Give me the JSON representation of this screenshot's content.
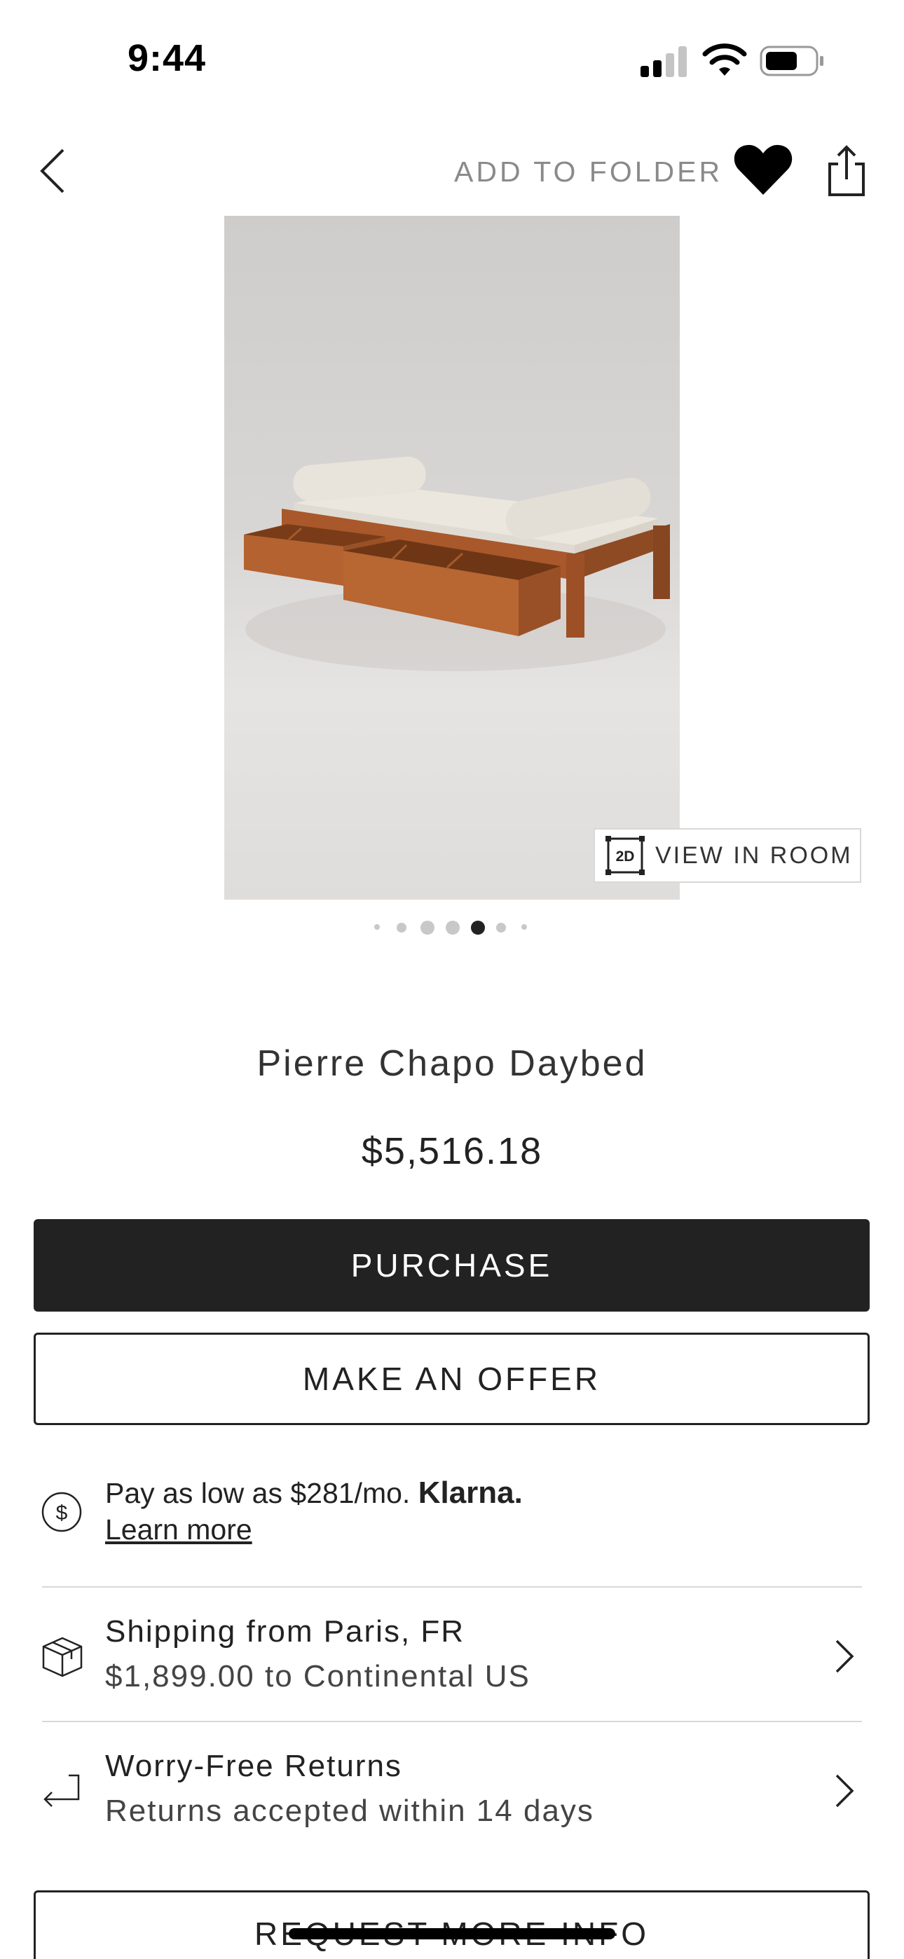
{
  "status_bar": {
    "time": "9:44"
  },
  "nav": {
    "add_to_folder": "ADD TO FOLDER"
  },
  "product": {
    "view_in_room": "VIEW IN ROOM",
    "view_in_room_badge": "2D",
    "image_count": 7,
    "active_image_index": 4,
    "title": "Pierre Chapo Daybed",
    "price": "$5,516.18"
  },
  "actions": {
    "purchase": "PURCHASE",
    "make_offer": "MAKE AN OFFER",
    "request_info": "REQUEST MORE INFO"
  },
  "klarna": {
    "text": "Pay as low as $281/mo.",
    "brand": "Klarna.",
    "link": "Learn more",
    "icon_symbol": "$"
  },
  "shipping": {
    "title": "Shipping from Paris, FR",
    "detail": "$1,899.00 to Continental US"
  },
  "returns": {
    "title": "Worry-Free Returns",
    "detail": "Returns accepted within 14 days"
  },
  "icons": {
    "back": "chevron-left-icon",
    "favorite": "heart-icon",
    "share": "share-icon",
    "shipping": "box-icon",
    "returns": "return-arrow-icon"
  },
  "colors": {
    "primary_button": "#222222",
    "text": "#222222",
    "muted": "#8a8a8a"
  }
}
